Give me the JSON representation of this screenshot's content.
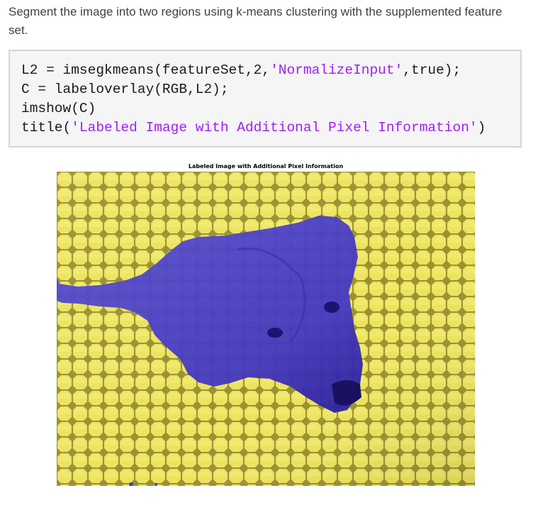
{
  "intro": {
    "text": "Segment the image into two regions using k-means clustering with the supplemented feature set."
  },
  "code": {
    "line1": {
      "pre": "L2 = imsegkmeans(featureSet,2,",
      "str": "'NormalizeInput'",
      "post": ",true);"
    },
    "line2": {
      "text": "C = labeloverlay(RGB,L2);"
    },
    "line3": {
      "text": "imshow(C)"
    },
    "line4": {
      "pre": "title(",
      "str": "'Labeled Image with Additional Pixel Information'",
      "post": ")"
    }
  },
  "figure": {
    "title": "Labeled Image with Additional Pixel Information"
  },
  "colors": {
    "string_literal": "#a020f0",
    "background_overlay": "#e8e05a",
    "dog_overlay": "#4a3fc8"
  }
}
